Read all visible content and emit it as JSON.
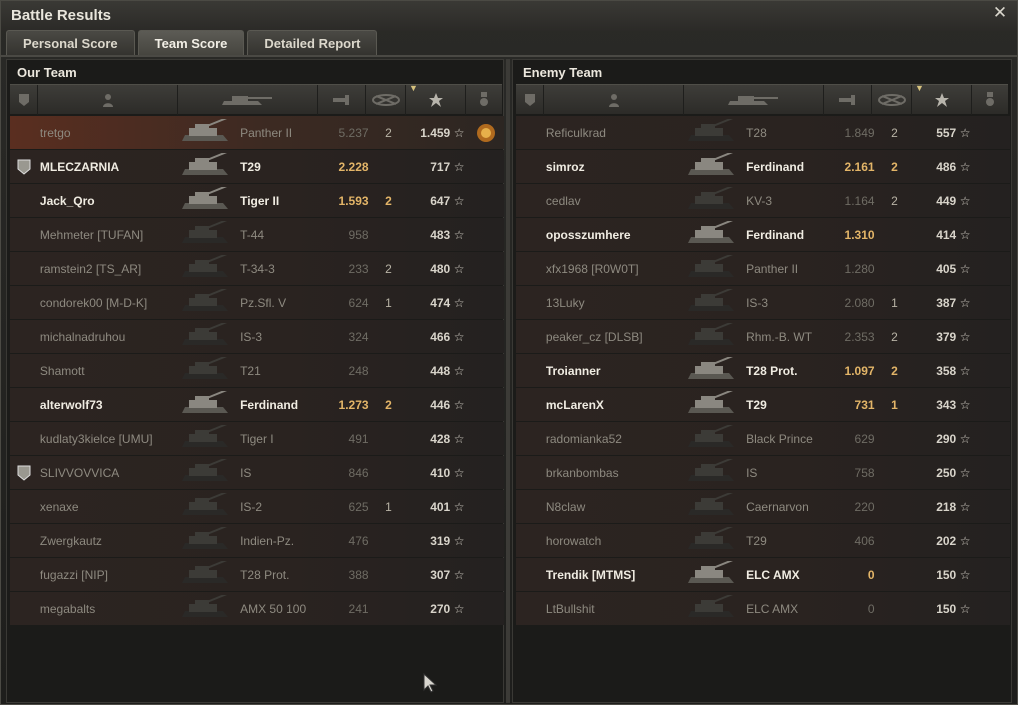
{
  "window": {
    "title": "Battle Results"
  },
  "tabs": [
    {
      "label": "Personal Score"
    },
    {
      "label": "Team Score"
    },
    {
      "label": "Detailed Report"
    }
  ],
  "our_team": {
    "title": "Our Team",
    "rows": [
      {
        "player": "tretgo",
        "tank": "Panther II",
        "damage": "5.237",
        "kills": "2",
        "xp": "1.459",
        "alive": false,
        "me": true,
        "platoon": false,
        "medal": true
      },
      {
        "player": "MLECZARNIA",
        "tank": "T29",
        "damage": "2.228",
        "kills": "",
        "xp": "717",
        "alive": true,
        "platoon": true
      },
      {
        "player": "Jack_Qro",
        "tank": "Tiger II",
        "damage": "1.593",
        "kills": "2",
        "xp": "647",
        "alive": true
      },
      {
        "player": "Mehmeter [TUFAN]",
        "tank": "T-44",
        "damage": "958",
        "kills": "",
        "xp": "483",
        "alive": false
      },
      {
        "player": "ramstein2 [TS_AR]",
        "tank": "T-34-3",
        "damage": "233",
        "kills": "2",
        "xp": "480",
        "alive": false
      },
      {
        "player": "condorek00 [M-D-K]",
        "tank": "Pz.Sfl. V",
        "damage": "624",
        "kills": "1",
        "xp": "474",
        "alive": false
      },
      {
        "player": "michalnadruhou",
        "tank": "IS-3",
        "damage": "324",
        "kills": "",
        "xp": "466",
        "alive": false
      },
      {
        "player": "Shamott",
        "tank": "T21",
        "damage": "248",
        "kills": "",
        "xp": "448",
        "alive": false
      },
      {
        "player": "alterwolf73",
        "tank": "Ferdinand",
        "damage": "1.273",
        "kills": "2",
        "xp": "446",
        "alive": true
      },
      {
        "player": "kudlaty3kielce [UMU]",
        "tank": "Tiger I",
        "damage": "491",
        "kills": "",
        "xp": "428",
        "alive": false
      },
      {
        "player": "SLIVVOVVICA",
        "tank": "IS",
        "damage": "846",
        "kills": "",
        "xp": "410",
        "alive": false,
        "platoon": true
      },
      {
        "player": "xenaxe",
        "tank": "IS-2",
        "damage": "625",
        "kills": "1",
        "xp": "401",
        "alive": false
      },
      {
        "player": "Zwergkautz",
        "tank": "Indien-Pz.",
        "damage": "476",
        "kills": "",
        "xp": "319",
        "alive": false
      },
      {
        "player": "fugazzi [NIP]",
        "tank": "T28 Prot.",
        "damage": "388",
        "kills": "",
        "xp": "307",
        "alive": false
      },
      {
        "player": "megabalts",
        "tank": "AMX 50 100",
        "damage": "241",
        "kills": "",
        "xp": "270",
        "alive": false
      }
    ]
  },
  "enemy_team": {
    "title": "Enemy Team",
    "rows": [
      {
        "player": "Reficulkrad",
        "tank": "T28",
        "damage": "1.849",
        "kills": "2",
        "xp": "557",
        "alive": false
      },
      {
        "player": "simroz",
        "tank": "Ferdinand",
        "damage": "2.161",
        "kills": "2",
        "xp": "486",
        "alive": true
      },
      {
        "player": "cedlav",
        "tank": "KV-3",
        "damage": "1.164",
        "kills": "2",
        "xp": "449",
        "alive": false
      },
      {
        "player": "oposszumhere",
        "tank": "Ferdinand",
        "damage": "1.310",
        "kills": "",
        "xp": "414",
        "alive": true
      },
      {
        "player": "xfx1968 [R0W0T]",
        "tank": "Panther II",
        "damage": "1.280",
        "kills": "",
        "xp": "405",
        "alive": false
      },
      {
        "player": "13Luky",
        "tank": "IS-3",
        "damage": "2.080",
        "kills": "1",
        "xp": "387",
        "alive": false
      },
      {
        "player": "peaker_cz [DLSB]",
        "tank": "Rhm.-B. WT",
        "damage": "2.353",
        "kills": "2",
        "xp": "379",
        "alive": false
      },
      {
        "player": "Troianner",
        "tank": "T28 Prot.",
        "damage": "1.097",
        "kills": "2",
        "xp": "358",
        "alive": true
      },
      {
        "player": "mcLarenX",
        "tank": "T29",
        "damage": "731",
        "kills": "1",
        "xp": "343",
        "alive": true
      },
      {
        "player": "radomianka52",
        "tank": "Black Prince",
        "damage": "629",
        "kills": "",
        "xp": "290",
        "alive": false
      },
      {
        "player": "brkanbombas",
        "tank": "IS",
        "damage": "758",
        "kills": "",
        "xp": "250",
        "alive": false
      },
      {
        "player": "N8claw",
        "tank": "Caernarvon",
        "damage": "220",
        "kills": "",
        "xp": "218",
        "alive": false
      },
      {
        "player": "horowatch",
        "tank": "T29",
        "damage": "406",
        "kills": "",
        "xp": "202",
        "alive": false
      },
      {
        "player": "Trendik [MTMS]",
        "tank": "ELC AMX",
        "damage": "0",
        "kills": "",
        "xp": "150",
        "alive": true
      },
      {
        "player": "LtBullshit",
        "tank": "ELC AMX",
        "damage": "0",
        "kills": "",
        "xp": "150",
        "alive": false
      }
    ]
  },
  "columns": [
    "squad-icon",
    "player-icon",
    "tank-icon",
    "damage-icon",
    "kills-icon",
    "xp-star-icon",
    "medal-icon"
  ],
  "colors": {
    "accent": "#e3b568",
    "highlight_row": "#5a2e20"
  }
}
